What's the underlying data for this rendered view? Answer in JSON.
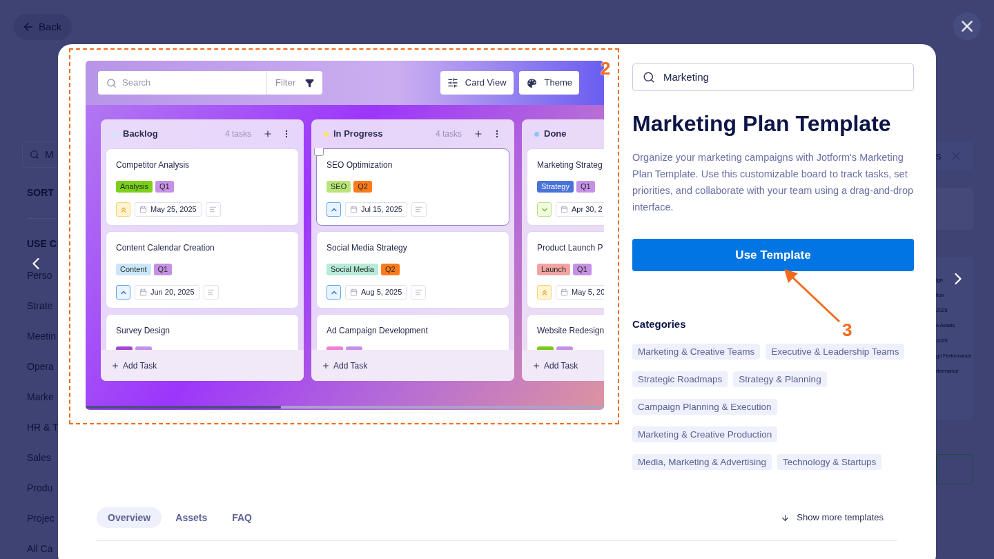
{
  "background": {
    "back_button": "Back",
    "search_value": "M",
    "sort_label": "SORT",
    "use_case_label": "USE C",
    "categories": [
      "Perso",
      "Strate",
      "Meetin",
      "Opera",
      "Marke",
      "HR & T",
      "Sales",
      "Produ",
      "Projec",
      "All Ca"
    ],
    "right_search_tail": "s",
    "right_card_texts": [
      "ign",
      "tion",
      "2025",
      "e Assets",
      "2025",
      "gn Performance",
      "rformance"
    ]
  },
  "modal": {
    "preview": {
      "search_placeholder": "Search",
      "filter_button": "Filter",
      "buttons": [
        "Card View",
        "Theme"
      ],
      "columns": [
        {
          "name": "Backlog",
          "color": "#cfe6fb",
          "count": "4 tasks",
          "add_task": "Add Task",
          "cards": [
            {
              "title": "Competitor Analysis",
              "selected": false,
              "tags": [
                {
                  "label": "Analysis",
                  "color": "#7ccf1a"
                },
                {
                  "label": "Q1",
                  "color": "#c590e6"
                }
              ],
              "kind": "high",
              "date": "May 25, 2025"
            },
            {
              "title": "Content Calendar Creation",
              "selected": false,
              "tags": [
                {
                  "label": "Content",
                  "color": "#cbe6fb"
                },
                {
                  "label": "Q1",
                  "color": "#c590e6"
                }
              ],
              "kind": "medium",
              "date": "Jun 20, 2025"
            },
            {
              "title": "Survey Design",
              "selected": false,
              "tags": [
                {
                  "color": "#a347d6"
                },
                {
                  "color": "#c590e6"
                }
              ]
            }
          ]
        },
        {
          "name": "In Progress",
          "color": "#fde468",
          "count": "4 tasks",
          "add_task": "Add Task",
          "cards": [
            {
              "title": "SEO Optimization",
              "selected": true,
              "tags": [
                {
                  "label": "SEO",
                  "color": "#b9e57a"
                },
                {
                  "label": "Q2",
                  "color": "#ff7a1a"
                }
              ],
              "kind": "medium",
              "date": "Jul 15, 2025"
            },
            {
              "title": "Social Media Strategy",
              "selected": false,
              "tags": [
                {
                  "label": "Social Media",
                  "color": "#b7eadb"
                },
                {
                  "label": "Q2",
                  "color": "#ff7a1a"
                }
              ],
              "kind": "medium",
              "date": "Aug 5, 2025"
            },
            {
              "title": "Ad Campaign Development",
              "selected": false,
              "tags": [
                {
                  "color": "#ef7fd7"
                },
                {
                  "color": "#c590e6"
                }
              ]
            }
          ]
        },
        {
          "name": "Done",
          "color": "#8cc6f4",
          "add_task": "Add Task",
          "cards": [
            {
              "title": "Marketing Strateg",
              "selected": false,
              "tags": [
                {
                  "label": "Strategy",
                  "color": "#4a73d9"
                },
                {
                  "label": "Q1",
                  "color": "#c590e6"
                }
              ],
              "kind": "low",
              "date": "Apr 30, 2"
            },
            {
              "title": "Product Launch P",
              "selected": false,
              "tags": [
                {
                  "label": "Launch",
                  "color": "#f2a3a3"
                },
                {
                  "label": "Q1",
                  "color": "#c590e6"
                }
              ],
              "kind": "high",
              "date": "May 5, 20"
            },
            {
              "title": "Website Redesign",
              "selected": false,
              "tags": [
                {
                  "color": "#7cc81a"
                },
                {
                  "color": "#c590e6"
                }
              ]
            }
          ]
        }
      ]
    },
    "search_value": "Marketing",
    "title": "Marketing Plan Template",
    "description": "Organize your marketing campaigns with Jotform's Marketing Plan Template. Use this customizable board to track tasks, set priorities, and collaborate with your team using a drag-and-drop interface.",
    "use_button": "Use Template",
    "categories_heading": "Categories",
    "categories": [
      "Marketing & Creative Teams",
      "Executive & Leadership Teams",
      "Strategic Roadmaps",
      "Strategy & Planning",
      "Campaign Planning & Execution",
      "Marketing & Creative Production",
      "Media, Marketing & Advertising",
      "Technology & Startups"
    ],
    "tabs": [
      {
        "label": "Overview",
        "selected": true
      },
      {
        "label": "Assets",
        "selected": false
      },
      {
        "label": "FAQ",
        "selected": false
      }
    ],
    "show_more": "Show more templates"
  },
  "annotations": [
    {
      "label": "2"
    },
    {
      "label": "3"
    }
  ]
}
